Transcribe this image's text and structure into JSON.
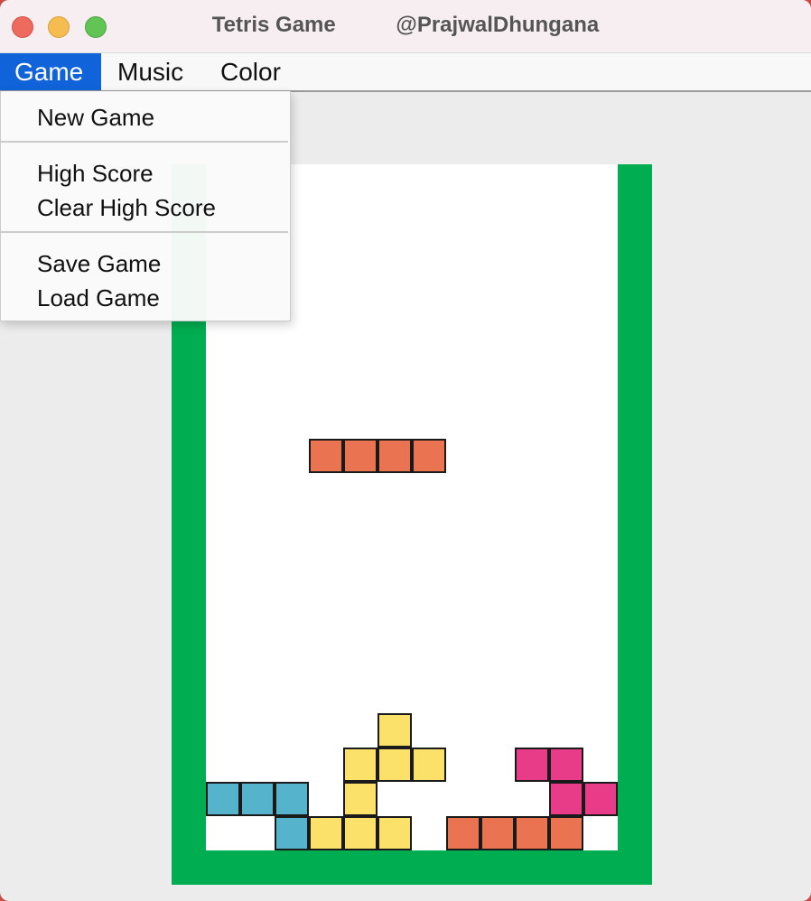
{
  "window": {
    "title": "Tetris Game          @PrajwalDhungana"
  },
  "menubar": {
    "items": [
      {
        "label": "Game",
        "active": true
      },
      {
        "label": "Music",
        "active": false
      },
      {
        "label": "Color",
        "active": false
      }
    ]
  },
  "game_menu": {
    "items": [
      {
        "label": "New Game"
      },
      {
        "label": "High Score"
      },
      {
        "label": "Clear High Score"
      },
      {
        "label": "Save Game"
      },
      {
        "label": "Load Game"
      }
    ]
  },
  "board": {
    "columns": 12,
    "rows": 20,
    "frame_color": "#00ad50",
    "colors": {
      "orange": "#ea7451",
      "yellow": "#fbe06a",
      "blue": "#55b3cb",
      "pink": "#e83c88"
    },
    "falling_piece": {
      "color": "orange",
      "cells": [
        [
          3,
          8
        ],
        [
          4,
          8
        ],
        [
          5,
          8
        ],
        [
          6,
          8
        ]
      ]
    },
    "settled_cells": [
      {
        "color": "yellow",
        "col": 5,
        "row": 16
      },
      {
        "color": "yellow",
        "col": 4,
        "row": 17
      },
      {
        "color": "yellow",
        "col": 5,
        "row": 17
      },
      {
        "color": "yellow",
        "col": 6,
        "row": 17
      },
      {
        "color": "yellow",
        "col": 4,
        "row": 18
      },
      {
        "color": "yellow",
        "col": 3,
        "row": 19
      },
      {
        "color": "yellow",
        "col": 4,
        "row": 19
      },
      {
        "color": "yellow",
        "col": 5,
        "row": 19
      },
      {
        "color": "blue",
        "col": 0,
        "row": 18
      },
      {
        "color": "blue",
        "col": 1,
        "row": 18
      },
      {
        "color": "blue",
        "col": 2,
        "row": 18
      },
      {
        "color": "blue",
        "col": 2,
        "row": 19
      },
      {
        "color": "pink",
        "col": 9,
        "row": 17
      },
      {
        "color": "pink",
        "col": 10,
        "row": 17
      },
      {
        "color": "pink",
        "col": 10,
        "row": 18
      },
      {
        "color": "pink",
        "col": 11,
        "row": 18
      },
      {
        "color": "orange",
        "col": 7,
        "row": 19
      },
      {
        "color": "orange",
        "col": 8,
        "row": 19
      },
      {
        "color": "orange",
        "col": 9,
        "row": 19
      },
      {
        "color": "orange",
        "col": 10,
        "row": 19
      }
    ]
  }
}
